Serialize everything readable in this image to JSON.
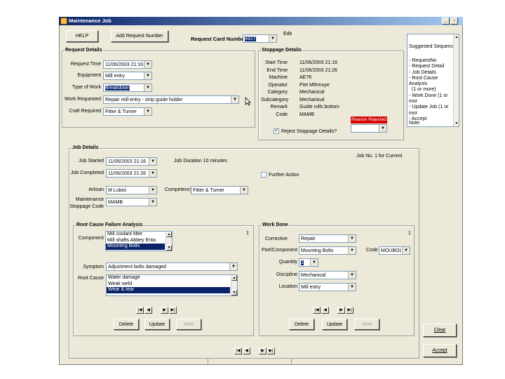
{
  "window": {
    "title": "Maintenance Job"
  },
  "toolbar": {
    "help": "HELP",
    "add_request": "Add Request Number",
    "request_card_label": "Request Card Number:",
    "request_card_value": "4827",
    "edit_label": "Edit"
  },
  "suggested": {
    "heading": "Suggested Sequence:",
    "items": [
      "- RequestNo",
      "- Request Detail",
      "- Job Details",
      "- Root Cause Analysis",
      "  (1 or more)",
      "- Work Done (1 or mor",
      "- Update Job (1 or mor",
      "- Accept"
    ],
    "note": "Note:"
  },
  "request_details": {
    "title": "Request Details",
    "request_time_label": "Request Time",
    "request_time": "11/06/2003  21:16",
    "equipment_label": "Equipment",
    "equipment": "Mill entry",
    "type_label": "Type of Work",
    "type": "Breakdown",
    "work_label": "Work Requested",
    "work": "Repair mill entry - strip guide holder",
    "craft_label": "Craft Required",
    "craft": "Fitter & Turner"
  },
  "stoppage": {
    "title": "Stoppage Details",
    "rows": [
      {
        "label": "Start Time",
        "value": "11/06/2003  21:16"
      },
      {
        "label": "End Time",
        "value": "11/06/2003  21:26"
      },
      {
        "label": "Machine",
        "value": "AE76"
      },
      {
        "label": "Operator",
        "value": "Piet Mthmuye"
      },
      {
        "label": "Category",
        "value": "Mechanical"
      },
      {
        "label": "Subcategory",
        "value": "Mechanical"
      },
      {
        "label": "Remark",
        "value": "Guide rolls bottom"
      },
      {
        "label": "Code",
        "value": "MAMB"
      }
    ],
    "reason_rejected": "Reason Rejected",
    "reject_label": "Reject Stoppage Details?",
    "reject_mark": "✓"
  },
  "job": {
    "title": "Job Details",
    "started_label": "Job Started",
    "started": "11/06/2003  21:16",
    "completed_label": "Job Completed",
    "completed": "11/06/2003  21:26",
    "duration": "Job Duration   10  minutes",
    "jobno": "Job No.  1   for Current",
    "further": "Further Action",
    "artisan_label": "Artisan",
    "artisan": "M Lubisi",
    "competency_label": "Competency",
    "competency": "Fitter & Turner",
    "msc_label1": "Maintenance",
    "msc_label2": "Stoppage Code",
    "msc": "MAMB"
  },
  "rca": {
    "title": "Root Cause Failure Analysis",
    "component_label": "Component",
    "components": [
      "Mill coolant filter",
      "Mill shafts Abbey Enta",
      "Mounting Bolts"
    ],
    "count": "1",
    "symptom_label": "Symptom",
    "symptom": "Adjustment bolts damaged",
    "root_cause_label": "Root Cause",
    "root_causes": [
      "Water damage",
      "Weak weld",
      "Wear & tear"
    ],
    "delete": "Delete",
    "update": "Update",
    "new": "New"
  },
  "work_done": {
    "title": "Work Done",
    "corrective_label": "Corrective",
    "corrective": "Repair",
    "part_label": "Part/Component",
    "part": "Mounting Bolts",
    "code_label": "Code",
    "code": "MOUBOL",
    "quantity_label": "Quantity",
    "quantity": "1",
    "discipline_label": "Discipline",
    "discipline": "Mechanical",
    "location_label": "Location",
    "location": "Mill entry",
    "count": "1",
    "delete": "Delete",
    "update": "Update",
    "new": "New"
  },
  "side": {
    "clear": "Clear",
    "accept": "Accept"
  },
  "nav": {
    "first": "|◀",
    "prev": "◀",
    "next": "▶",
    "last": "▶|"
  },
  "colors": {
    "title_start": "#0a246a",
    "title_end": "#a6caf0",
    "selection": "#0a246a",
    "reason_bg": "#d40000"
  }
}
